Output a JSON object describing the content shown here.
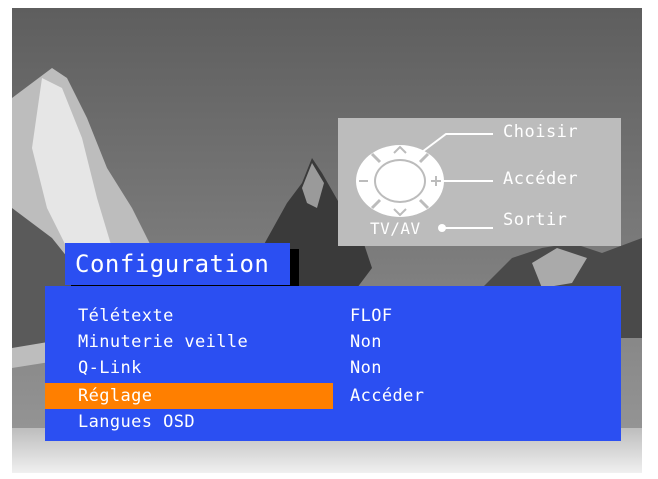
{
  "help": {
    "choose_label": "Choisir",
    "enter_label": "Accéder",
    "exit_label": "Sortir",
    "tvav_label": "TV/AV"
  },
  "menu": {
    "title": "Configuration",
    "selected_index": 3,
    "items": [
      {
        "label": "Télétexte",
        "value": "FLOF"
      },
      {
        "label": "Minuterie veille",
        "value": "Non"
      },
      {
        "label": "Q-Link",
        "value": "Non"
      },
      {
        "label": "Réglage",
        "value": "Accéder"
      },
      {
        "label": "Langues OSD",
        "value": ""
      }
    ]
  },
  "colors": {
    "menu_blue": "#2b4ff2",
    "highlight_orange": "#ff7f00",
    "help_panel_gray": "#bcbcbc"
  }
}
